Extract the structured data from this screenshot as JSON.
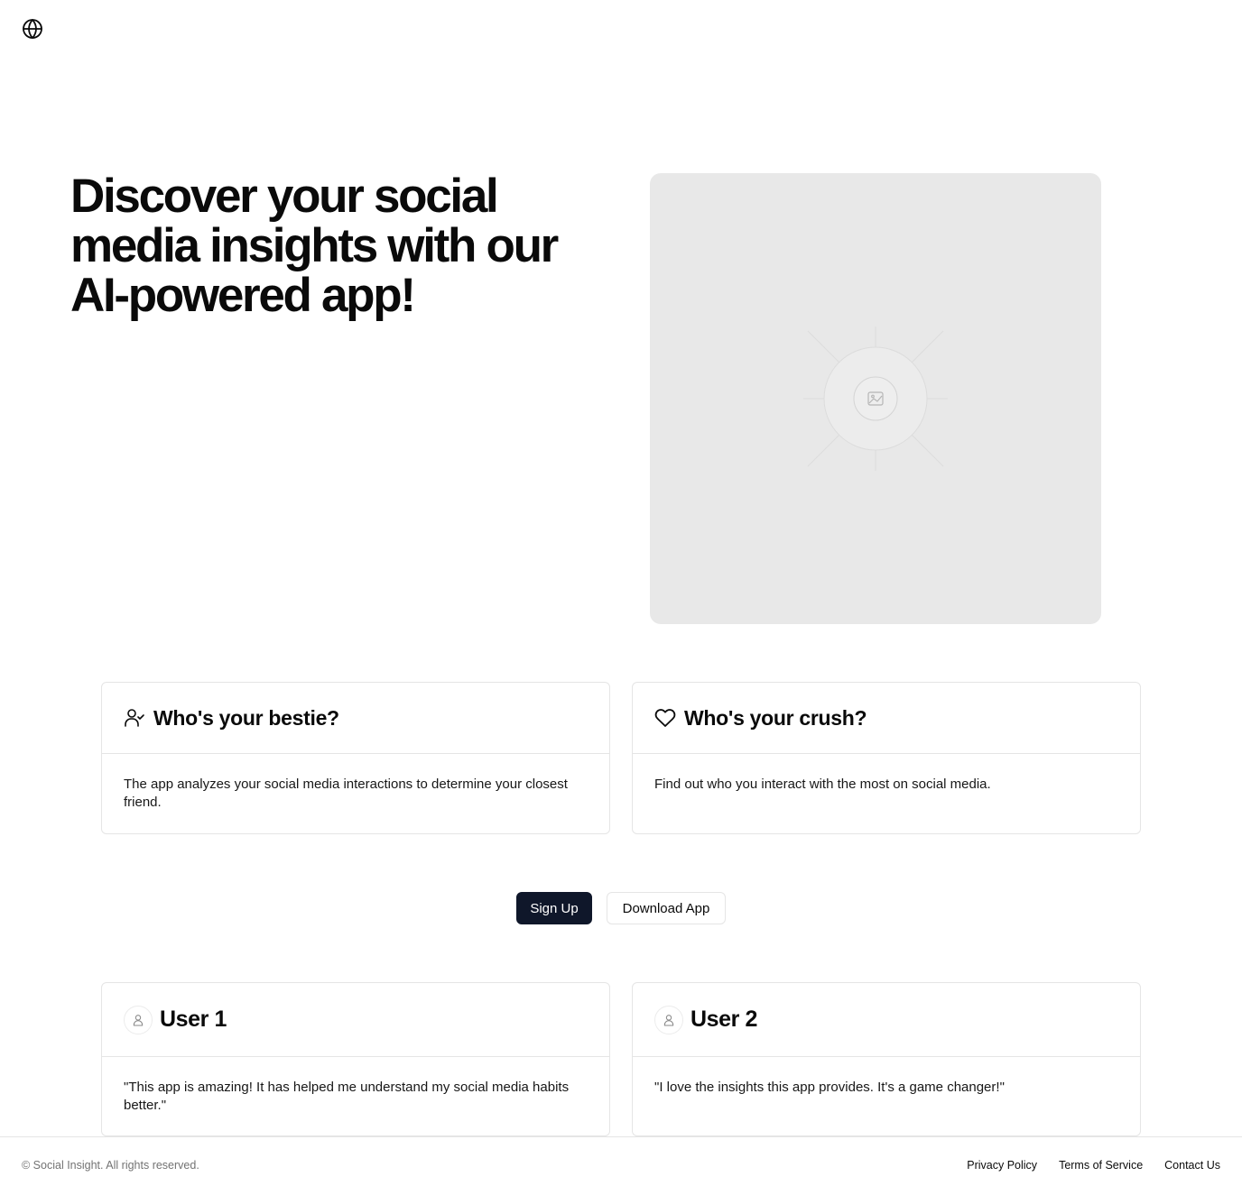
{
  "header": {
    "logo_icon": "globe-icon"
  },
  "hero": {
    "title": "Discover your social media insights with our AI-powered app!",
    "image_icon": "image-placeholder-icon"
  },
  "features": [
    {
      "icon": "user-check-icon",
      "title": "Who's your bestie?",
      "description": "The app analyzes your social media interactions to determine your closest friend."
    },
    {
      "icon": "heart-icon",
      "title": "Who's your crush?",
      "description": "Find out who you interact with the most on social media."
    }
  ],
  "cta": {
    "primary_label": "Sign Up",
    "secondary_label": "Download App"
  },
  "testimonials": [
    {
      "icon": "user-icon",
      "name": "User 1",
      "quote": "\"This app is amazing! It has helped me understand my social media habits better.\""
    },
    {
      "icon": "user-icon",
      "name": "User 2",
      "quote": "\"I love the insights this app provides. It's a game changer!\""
    }
  ],
  "footer": {
    "copyright": "© Social Insight. All rights reserved.",
    "links": [
      "Privacy Policy",
      "Terms of Service",
      "Contact Us"
    ]
  },
  "colors": {
    "primary_button": "#0f172a",
    "placeholder_bg": "#e8e8e8",
    "border": "#e5e5e5",
    "muted_text": "#737373"
  }
}
